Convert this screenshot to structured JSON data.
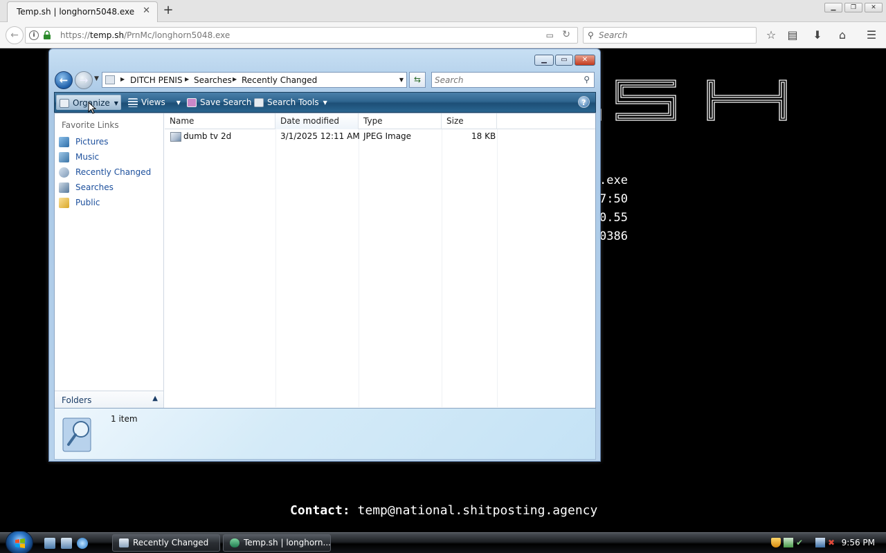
{
  "browser": {
    "tab_title": "Temp.sh | longhorn5048.exe",
    "url_prefix": "https://",
    "url_host": "temp.sh",
    "url_path": "/PrnMc/longhorn5048.exe",
    "search_placeholder": "Search"
  },
  "page": {
    "meta_lines": [
      ".exe",
      "7:50",
      "0.55",
      "0386"
    ],
    "contact_label": "Contact:",
    "contact_email": "temp@national.shitposting.agency"
  },
  "explorer": {
    "breadcrumbs": [
      "DITCH PENIS",
      "Searches",
      "Recently Changed"
    ],
    "search_placeholder": "Search",
    "toolbar": {
      "organize": "Organize",
      "views": "Views",
      "save_search": "Save Search",
      "search_tools": "Search Tools"
    },
    "nav": {
      "heading": "Favorite Links",
      "items": [
        {
          "label": "Pictures",
          "icon": "pictures-icon"
        },
        {
          "label": "Music",
          "icon": "music-icon"
        },
        {
          "label": "Recently Changed",
          "icon": "recently-changed-icon"
        },
        {
          "label": "Searches",
          "icon": "searches-icon"
        },
        {
          "label": "Public",
          "icon": "public-folder-icon"
        }
      ],
      "folders_label": "Folders"
    },
    "columns": [
      "Name",
      "Date modified",
      "Type",
      "Size"
    ],
    "files": [
      {
        "name": "dumb tv 2d",
        "date": "3/1/2025 12:11 AM",
        "type": "JPEG Image",
        "size": "18 KB"
      }
    ],
    "status": "1 item"
  },
  "taskbar": {
    "buttons": [
      {
        "label": "Recently Changed"
      },
      {
        "label": "Temp.sh | longhorn..."
      }
    ],
    "clock": "9:56 PM"
  },
  "colors": {
    "page_background": "#000000",
    "explorer_toolbar": "#2f6690",
    "nav_link": "#1c4f9c"
  }
}
